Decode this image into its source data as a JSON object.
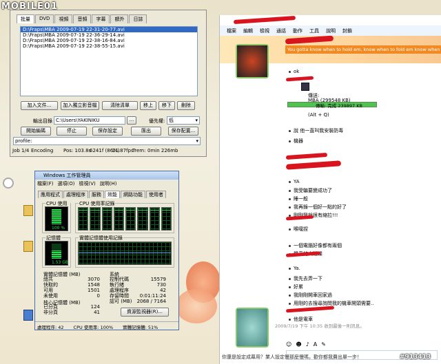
{
  "logo": "MOBILE01",
  "watermark": "#913413",
  "encoder": {
    "tabs": [
      "批量",
      "DVD",
      "視頻",
      "音頻",
      "字幕",
      "額外",
      "日誌"
    ],
    "active_tab": 0,
    "files": [
      "D:\\Fraps\\MBA 2009-07-19 22-31-20-77.avi",
      "D:\\Fraps\\MBA 2009-07-19 22-36-29-14.avi",
      "D:\\Fraps\\MBA 2009-07-19 22-38-16-84.avi",
      "D:\\Fraps\\MBA 2009-07-19 22-38-55-15.avi"
    ],
    "list_buttons": [
      "加入文件...",
      "加入獨立影音檔",
      "清除清單",
      "移上",
      "移下",
      "刪除"
    ],
    "output_label": "輸出目錄",
    "output_value": "C:\\Users\\YAKINIKU",
    "browse": "...",
    "priority_label": "優先權:",
    "priority_value": "低",
    "action_buttons": [
      "開始編碼",
      "停止",
      "保存設定",
      "匯出",
      "保存配置..."
    ],
    "profile_value": "profile:",
    "status": {
      "job": "Job 1/4",
      "state": "Encoding",
      "pos": "Pos: 103.8s",
      "frames": "6241f (86%)",
      "fps": "21.87fps",
      "trem": "Trem:",
      "trem_val": "0min 226mb"
    }
  },
  "taskmgr": {
    "title": "Windows 工作管理員",
    "menu": [
      "檔案(F)",
      "選項(O)",
      "檢視(V)",
      "說明(H)"
    ],
    "tabs": [
      "應用程式",
      "處理程序",
      "服務",
      "效能",
      "網路功能",
      "使用者"
    ],
    "active_tab": 3,
    "cpu_usage_label": "CPU 使用率",
    "cpu_history_label": "CPU 使用率記錄",
    "cpu_value": "100 %",
    "cpu_percent": 100,
    "mem_label": "記憶體",
    "mem_history_label": "實體記憶體使用記錄",
    "mem_value": "1.53 GB",
    "phys_title": "實體記憶體 (MB)",
    "phys": [
      [
        "總共",
        "3070"
      ],
      [
        "快取的",
        "1548"
      ],
      [
        "可用",
        "1501"
      ],
      [
        "未使用",
        "0"
      ]
    ],
    "sys_title": "系統",
    "sys": [
      [
        "控制代碼",
        "15579"
      ],
      [
        "執行緒",
        "730"
      ],
      [
        "處理程序",
        "42"
      ],
      [
        "存留時間",
        "0:01:11:24"
      ],
      [
        "認可 (MB)",
        "2068 / 7164"
      ]
    ],
    "kernel_title": "核心記憶體 (MB)",
    "kernel": [
      [
        "已分頁",
        "124"
      ],
      [
        "非分頁",
        "41"
      ]
    ],
    "resmon_button": "資源監視器(R)...",
    "status_procs": "處理程序: 42",
    "status_cpu": "CPU 使用率: 100%",
    "status_mem": "實體記憶體: 51%"
  },
  "chat": {
    "menu": [
      "檔案",
      "編輯",
      "檢視",
      "通話",
      "動作",
      "工具",
      "說明",
      "封鎖"
    ],
    "marquee": "You gotta know when to hold em, know when to fold em know when to walk a",
    "messages": [
      {
        "text": "ok",
        "bullet": true
      },
      {
        "text": "傳送:",
        "bullet": false
      },
      {
        "text": "MBA (299548 KB)",
        "bullet": false
      },
      {
        "text": "(Alt + Q)",
        "bullet": false
      },
      {
        "text": "說 他一直叫我安裝防毒",
        "bullet": true
      },
      {
        "text": "機器",
        "bullet": true
      },
      {
        "text": "YA",
        "bullet": true
      },
      {
        "text": "我受騙要變成功了",
        "bullet": true
      },
      {
        "text": "睡一般",
        "bullet": true
      },
      {
        "text": "我再錄一個好一點的好了",
        "bullet": true
      },
      {
        "text": "剛剛我就很有縮拉!!!",
        "bullet": true
      },
      {
        "text": "喉嚨捏",
        "bullet": true
      },
      {
        "text": "一個電腦好像都有兩個",
        "bullet": true
      },
      {
        "text": "聲音的大磁碟",
        "bullet": true
      },
      {
        "text": "Ya.",
        "bullet": true
      },
      {
        "text": "我先去弄一下",
        "bullet": true
      },
      {
        "text": "好累",
        "bullet": true
      },
      {
        "text": "我剛剛開車回家過",
        "bullet": true
      },
      {
        "text": "用剛的去搜尋詢問我的機車開頭需要..",
        "bullet": true
      },
      {
        "text": "他是電車",
        "bullet": true
      }
    ],
    "transfer_status": "傳輸: 完成 239897 KB",
    "transfer_percent": 100,
    "timestamp": "2009/7/19 下午 10:35 收到最後一則訊息。",
    "footer": "你還是設定成幕用？業人設定慢那麼慢嗎，歡你都我費出單一步！"
  },
  "colors": {
    "accent": "#316ac5",
    "chat_orange": "#f08a22",
    "graph_green": "#22e050",
    "scribble_red": "#d8141e"
  }
}
